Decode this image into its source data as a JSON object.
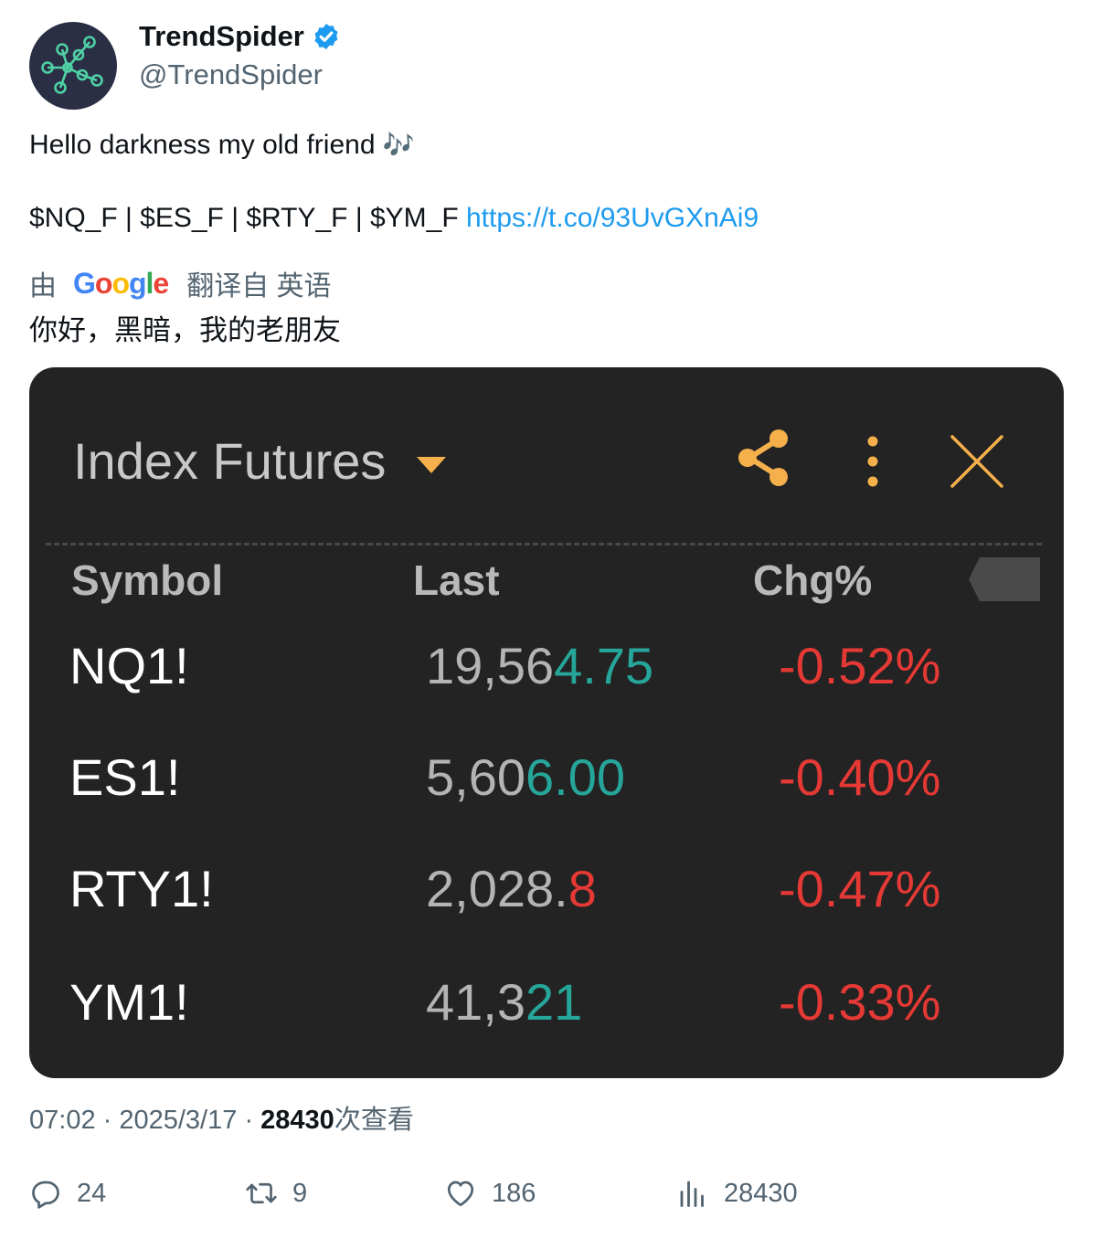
{
  "author": {
    "display_name": "TrendSpider",
    "handle": "@TrendSpider",
    "verified": true
  },
  "tweet": {
    "text_line1": "Hello darkness my old friend",
    "text_line1_emoji": "🎶",
    "tickers": "$NQ_F | $ES_F | $RTY_F | $YM_F",
    "link": "https://t.co/93UvGXnAi9"
  },
  "translation": {
    "prefix": "由",
    "provider": "Google",
    "suffix": "翻译自 英语",
    "text": "你好，黑暗，我的老朋友"
  },
  "widget": {
    "title": "Index Futures",
    "icons": [
      "caret-down-icon",
      "share-icon",
      "more-vertical-icon",
      "close-icon"
    ],
    "columns": [
      "Symbol",
      "Last",
      "Chg%"
    ],
    "rows": [
      {
        "symbol": "NQ1!",
        "last_dim": "19,56",
        "last_hl": "4.75",
        "hl_dir": "up",
        "chg": "-0.52%"
      },
      {
        "symbol": "ES1!",
        "last_dim": "5,60",
        "last_hl": "6.00",
        "hl_dir": "up",
        "chg": "-0.40%"
      },
      {
        "symbol": "RTY1!",
        "last_dim": "2,028.",
        "last_hl": "8",
        "hl_dir": "down",
        "chg": "-0.47%"
      },
      {
        "symbol": "YM1!",
        "last_dim": "41,3",
        "last_hl": "21",
        "hl_dir": "up",
        "chg": "-0.33%"
      }
    ],
    "colors": {
      "accent": "#f6b04b",
      "up": "#26a69a",
      "down": "#e53935",
      "background": "#232323"
    }
  },
  "meta": {
    "time": "07:02",
    "date": "2025/3/17",
    "views_count": "28430",
    "views_label": "次查看"
  },
  "actions": {
    "replies": "24",
    "retweets": "9",
    "likes": "186",
    "views": "28430"
  }
}
